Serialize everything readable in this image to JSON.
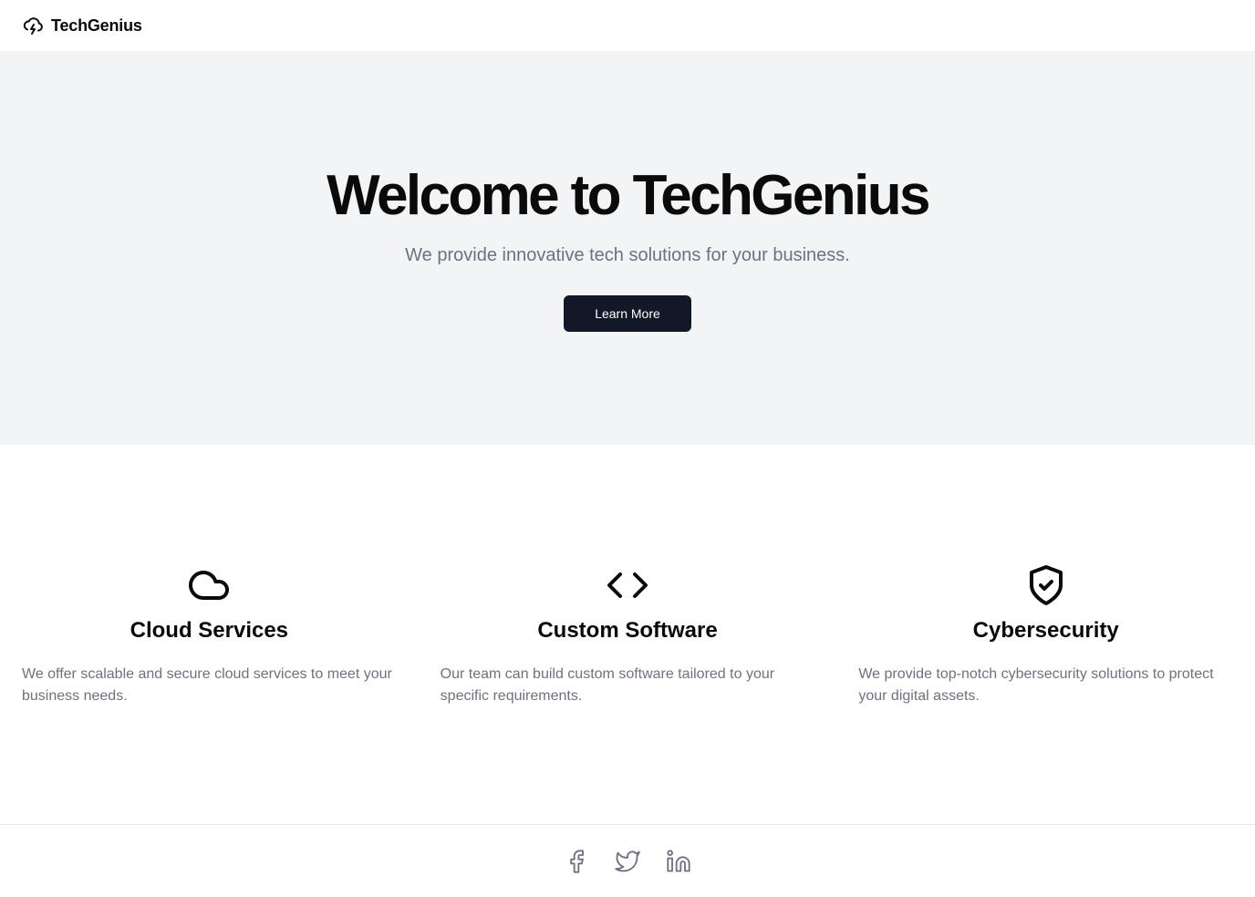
{
  "header": {
    "brand_name": "TechGenius",
    "brand_icon": "cloud-lightning-icon"
  },
  "hero": {
    "title": "Welcome to TechGenius",
    "subtitle": "We provide innovative tech solutions for your business.",
    "cta_label": "Learn More"
  },
  "features": [
    {
      "icon": "cloud-icon",
      "title": "Cloud Services",
      "description": "We offer scalable and secure cloud services to meet your business needs."
    },
    {
      "icon": "code-icon",
      "title": "Custom Software",
      "description": "Our team can build custom software tailored to your specific requirements."
    },
    {
      "icon": "shield-check-icon",
      "title": "Cybersecurity",
      "description": "We provide top-notch cybersecurity solutions to protect your digital assets."
    }
  ],
  "footer": {
    "social_icons": [
      "facebook-icon",
      "twitter-icon",
      "linkedin-icon"
    ]
  },
  "colors": {
    "hero_background": "#f2f4f6",
    "button_background": "#111827",
    "muted_text": "#6b7280",
    "border": "#e5e7eb"
  }
}
